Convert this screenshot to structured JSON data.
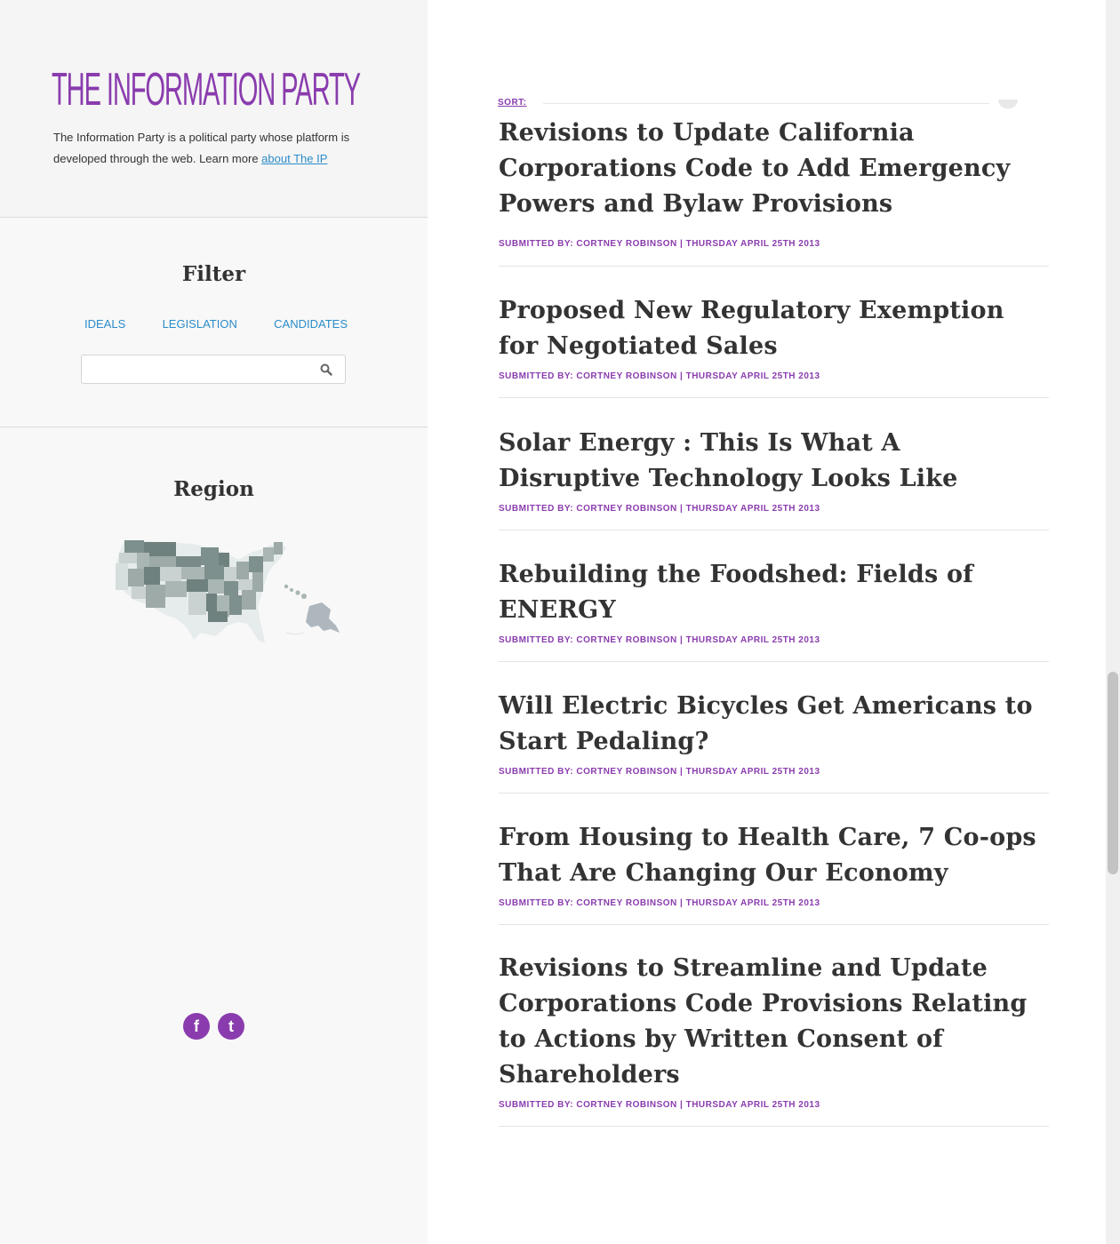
{
  "sidebar": {
    "logo": "THE INFORMATION PARTY",
    "intro_text": "The Information Party is a political party whose platform is developed through the web. Learn more ",
    "intro_link": "about The IP",
    "filter": {
      "title": "Filter",
      "tabs": [
        "IDEALS",
        "LEGISLATION",
        "CANDIDATES"
      ],
      "search_value": "",
      "search_icon": "search-icon"
    },
    "region": {
      "title": "Region",
      "map": "us-states-map"
    },
    "social": {
      "facebook_glyph": "f",
      "twitter_glyph": "t"
    }
  },
  "main": {
    "sort_label": "SORT:",
    "articles": [
      {
        "title": "Revisions to Update California Corporations Code to Add Emergency Powers and Bylaw Provisions",
        "meta": "SUBMITTED BY: CORTNEY ROBINSON | THURSDAY APRIL 25TH 2013"
      },
      {
        "title": "Proposed New Regulatory Exemption for Negotiated Sales",
        "meta": "SUBMITTED BY: CORTNEY ROBINSON | THURSDAY APRIL 25TH 2013"
      },
      {
        "title": "Solar Energy : This Is What A Disruptive Technology Looks Like",
        "meta": "SUBMITTED BY: CORTNEY ROBINSON | THURSDAY APRIL 25TH 2013"
      },
      {
        "title": "Rebuilding the Foodshed: Fields of ENERGY",
        "meta": "SUBMITTED BY: CORTNEY ROBINSON | THURSDAY APRIL 25TH 2013"
      },
      {
        "title": "Will Electric Bicycles Get Americans to Start Pedaling?",
        "meta": "SUBMITTED BY: CORTNEY ROBINSON | THURSDAY APRIL 25TH 2013"
      },
      {
        "title": "From Housing to Health Care, 7 Co-ops That Are Changing Our Economy",
        "meta": "SUBMITTED BY: CORTNEY ROBINSON | THURSDAY APRIL 25TH 2013"
      },
      {
        "title": "Revisions to Streamline and Update Corporations Code Provisions Relating to Actions by Written Consent of Shareholders",
        "meta": "SUBMITTED BY: CORTNEY ROBINSON | THURSDAY APRIL 25TH 2013"
      }
    ]
  },
  "colors": {
    "brand_purple": "#8a3cae",
    "link_blue": "#2b8bc8",
    "text_dark": "#333333"
  }
}
